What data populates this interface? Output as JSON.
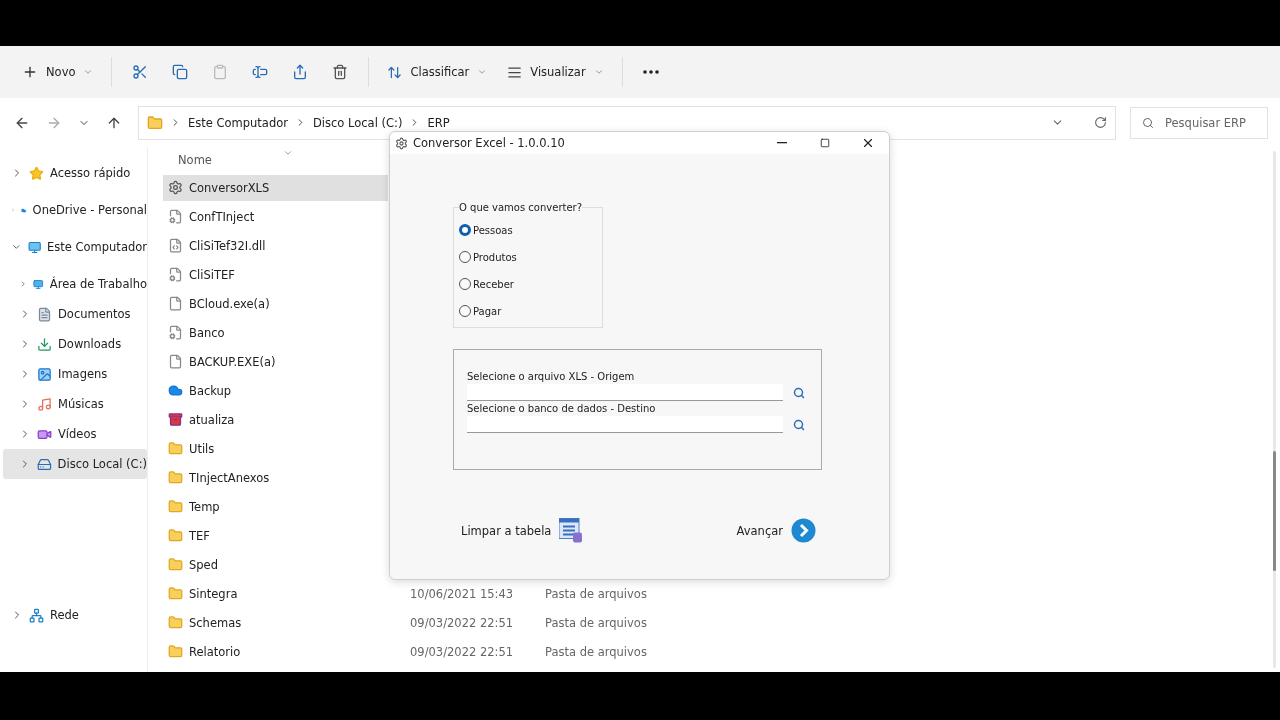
{
  "toolbar": {
    "new_button": {
      "label": "Novo"
    },
    "actions": [
      {
        "kind": "cut",
        "disabled": false
      },
      {
        "kind": "copy",
        "disabled": false
      },
      {
        "kind": "paste",
        "disabled": true
      },
      {
        "kind": "rename",
        "disabled": false
      },
      {
        "kind": "share",
        "disabled": false
      },
      {
        "kind": "delete",
        "disabled": false
      }
    ],
    "sort_button": {
      "label": "Classificar"
    },
    "view_button": {
      "label": "Visualizar"
    }
  },
  "address_bar": {
    "path": [
      "Este Computador",
      "Disco Local (C:)",
      "ERP"
    ]
  },
  "search": {
    "placeholder": "Pesquisar ERP"
  },
  "sidebar": {
    "groups": [
      [
        {
          "label": "Acesso rápido",
          "expanded": false,
          "selected": false
        },
        {
          "label": "OneDrive - Personal",
          "expanded": false,
          "selected": false
        },
        {
          "label": "Este Computador",
          "expanded": true,
          "selected": false,
          "children": [
            {
              "label": "Área de Trabalho",
              "expanded": false,
              "selected": false
            },
            {
              "label": "Documentos",
              "expanded": false,
              "selected": false
            },
            {
              "label": "Downloads",
              "expanded": false,
              "selected": false
            },
            {
              "label": "Imagens",
              "expanded": false,
              "selected": false
            },
            {
              "label": "Músicas",
              "expanded": false,
              "selected": false
            },
            {
              "label": "Vídeos",
              "expanded": false,
              "selected": false
            },
            {
              "label": "Disco Local (C:)",
              "expanded": false,
              "selected": true
            }
          ]
        }
      ],
      [
        {
          "label": "Rede",
          "expanded": false,
          "selected": false
        }
      ]
    ]
  },
  "file_list": {
    "columns": [
      "Nome"
    ],
    "rows": [
      {
        "name": "ConversorXLS",
        "kind": "app",
        "selected": true
      },
      {
        "name": "ConfTInject",
        "kind": "config",
        "selected": false
      },
      {
        "name": "CliSiTef32I.dll",
        "kind": "dll",
        "selected": false
      },
      {
        "name": "CliSiTEF",
        "kind": "config",
        "selected": false
      },
      {
        "name": "BCloud.exe(a)",
        "kind": "file",
        "selected": false
      },
      {
        "name": "Banco",
        "kind": "config",
        "selected": false
      },
      {
        "name": "BACKUP.EXE(a)",
        "kind": "file",
        "selected": false
      },
      {
        "name": "Backup",
        "kind": "cloud",
        "selected": false
      },
      {
        "name": "atualiza",
        "kind": "archive",
        "selected": false
      },
      {
        "name": "Utils",
        "kind": "folder",
        "selected": false
      },
      {
        "name": "TInjectAnexos",
        "kind": "folder",
        "selected": false
      },
      {
        "name": "Temp",
        "kind": "folder",
        "selected": false
      },
      {
        "name": "TEF",
        "kind": "folder",
        "selected": false
      },
      {
        "name": "Sped",
        "kind": "folder",
        "selected": false
      },
      {
        "name": "Sintegra",
        "kind": "folder",
        "selected": false,
        "date": "10/06/2021 15:43",
        "type": "Pasta de arquivos"
      },
      {
        "name": "Schemas",
        "kind": "folder",
        "selected": false,
        "date": "09/03/2022 22:51",
        "type": "Pasta de arquivos"
      },
      {
        "name": "Relatorio",
        "kind": "folder",
        "selected": false,
        "date": "09/03/2022 22:51",
        "type": "Pasta de arquivos"
      }
    ]
  },
  "dialog": {
    "title": "Conversor Excel - 1.0.0.10",
    "group": {
      "legend": "O que vamos converter?",
      "options": [
        {
          "label": "Pessoas",
          "selected": true
        },
        {
          "label": "Produtos",
          "selected": false
        },
        {
          "label": "Receber",
          "selected": false
        },
        {
          "label": "Pagar",
          "selected": false
        }
      ]
    },
    "fields": [
      {
        "label": "Selecione o arquivo XLS - Origem"
      },
      {
        "label": "Selecione o banco de dados - Destino"
      }
    ],
    "clear_button": {
      "label": "Limpar a tabela"
    },
    "next_button": {
      "label": "Avançar"
    }
  }
}
